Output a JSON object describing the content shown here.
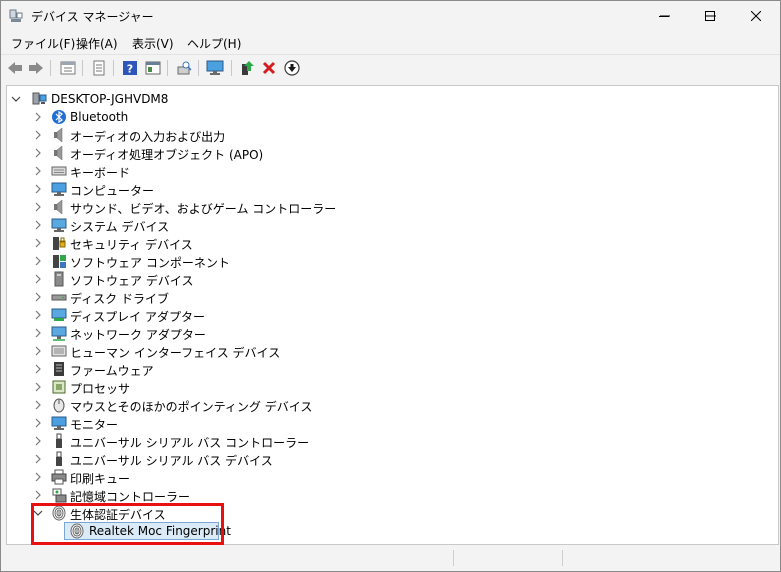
{
  "window": {
    "title": "デバイス マネージャー",
    "controls": {
      "minimize": "—",
      "maximize": "☐",
      "close": "✕"
    }
  },
  "menu": [
    {
      "label": "ファイル(F)"
    },
    {
      "label": "操作(A)"
    },
    {
      "label": "表示(V)"
    },
    {
      "label": "ヘルプ(H)"
    }
  ],
  "toolbar": [
    {
      "icon": "back-arrow-icon"
    },
    {
      "icon": "forward-arrow-icon"
    },
    {
      "icon": "properties-icon"
    },
    {
      "icon": "document-icon"
    },
    {
      "icon": "help-icon"
    },
    {
      "icon": "view-icon"
    },
    {
      "icon": "scan-hardware-icon"
    },
    {
      "icon": "monitor-icon"
    },
    {
      "icon": "update-driver-icon"
    },
    {
      "icon": "uninstall-icon"
    },
    {
      "icon": "disable-device-icon"
    }
  ],
  "tree": {
    "root": "DESKTOP-JGHVDM8",
    "categories": [
      {
        "label": "Bluetooth",
        "icon": "bluetooth-icon"
      },
      {
        "label": "オーディオの入力および出力",
        "icon": "speaker-icon"
      },
      {
        "label": "オーディオ処理オブジェクト (APO)",
        "icon": "speaker-icon"
      },
      {
        "label": "キーボード",
        "icon": "keyboard-icon"
      },
      {
        "label": "コンピューター",
        "icon": "computer-icon"
      },
      {
        "label": "サウンド、ビデオ、およびゲーム コントローラー",
        "icon": "speaker-icon"
      },
      {
        "label": "システム デバイス",
        "icon": "system-device-icon"
      },
      {
        "label": "セキュリティ デバイス",
        "icon": "security-device-icon"
      },
      {
        "label": "ソフトウェア コンポーネント",
        "icon": "software-component-icon"
      },
      {
        "label": "ソフトウェア デバイス",
        "icon": "software-device-icon"
      },
      {
        "label": "ディスク ドライブ",
        "icon": "disk-drive-icon"
      },
      {
        "label": "ディスプレイ アダプター",
        "icon": "display-adapter-icon"
      },
      {
        "label": "ネットワーク アダプター",
        "icon": "network-adapter-icon"
      },
      {
        "label": "ヒューマン インターフェイス デバイス",
        "icon": "hid-icon"
      },
      {
        "label": "ファームウェア",
        "icon": "firmware-icon"
      },
      {
        "label": "プロセッサ",
        "icon": "processor-icon"
      },
      {
        "label": "マウスとそのほかのポインティング デバイス",
        "icon": "mouse-icon"
      },
      {
        "label": "モニター",
        "icon": "monitor-icon"
      },
      {
        "label": "ユニバーサル シリアル バス コントローラー",
        "icon": "usb-icon"
      },
      {
        "label": "ユニバーサル シリアル バス デバイス",
        "icon": "usb-icon"
      },
      {
        "label": "印刷キュー",
        "icon": "printer-icon"
      },
      {
        "label": "記憶域コントローラー",
        "icon": "storage-controller-icon"
      },
      {
        "label": "生体認証デバイス",
        "icon": "fingerprint-icon",
        "expanded": true,
        "children": [
          {
            "label": "Realtek Moc Fingerprint",
            "icon": "fingerprint-icon",
            "selected": true
          }
        ]
      }
    ]
  },
  "highlight_color": "#e81010"
}
